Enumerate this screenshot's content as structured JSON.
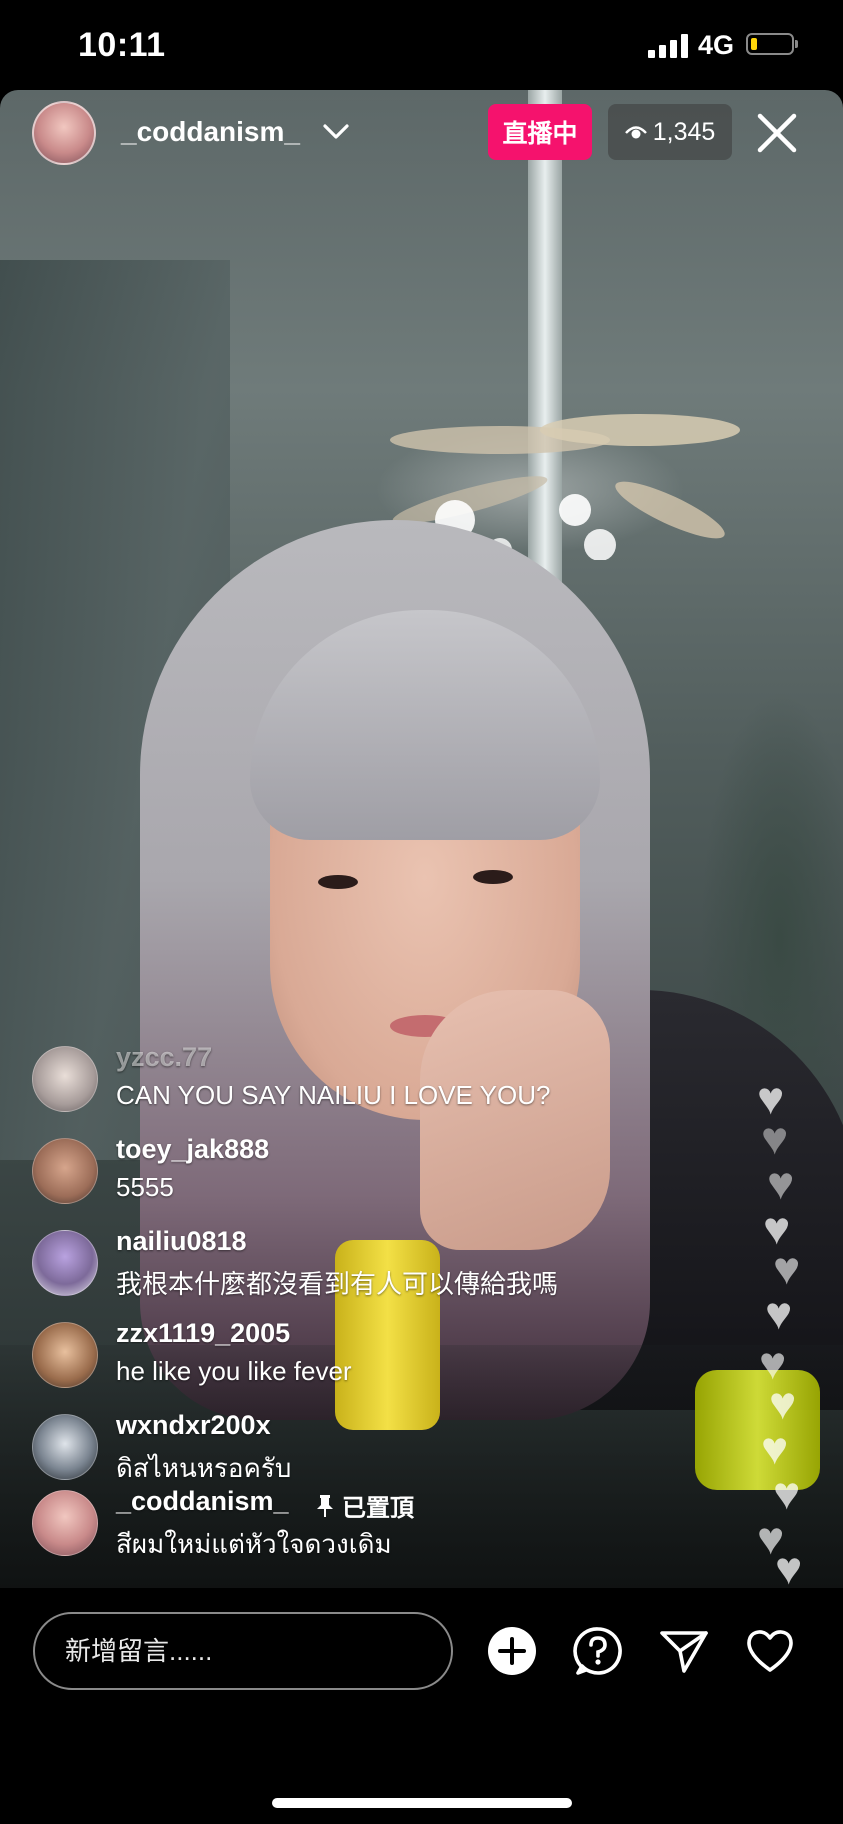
{
  "status_bar": {
    "time": "10:11",
    "network": "4G",
    "battery_level": 0.12,
    "battery_color": "#ffd60a"
  },
  "header": {
    "host_username": "_coddanism_",
    "live_label": "直播中",
    "live_color": "#f5126d",
    "viewer_count": "1,345",
    "icons": [
      "chevron-down-icon",
      "eye-icon",
      "close-icon"
    ]
  },
  "comments": [
    {
      "username": "yzcc.77",
      "text": "CAN YOU SAY NAILIU I LOVE YOU?"
    },
    {
      "username": "toey_jak888",
      "text": "5555"
    },
    {
      "username": "nailiu0818",
      "text": "我根本什麼都沒看到有人可以傳給我嗎"
    },
    {
      "username": "zzx1119_2005",
      "text": "he like you like fever"
    },
    {
      "username": "wxndxr200x",
      "text": "ดิสไหนหรอครับ"
    },
    {
      "username": "_coddanism_",
      "text": "สีผมใหม่แต่หัวใจดวงเดิม",
      "pinned_label": "已置頂"
    }
  ],
  "bottom_bar": {
    "comment_placeholder": "新增留言......",
    "icons": [
      "add-icon",
      "question-icon",
      "send-icon",
      "heart-icon"
    ]
  }
}
